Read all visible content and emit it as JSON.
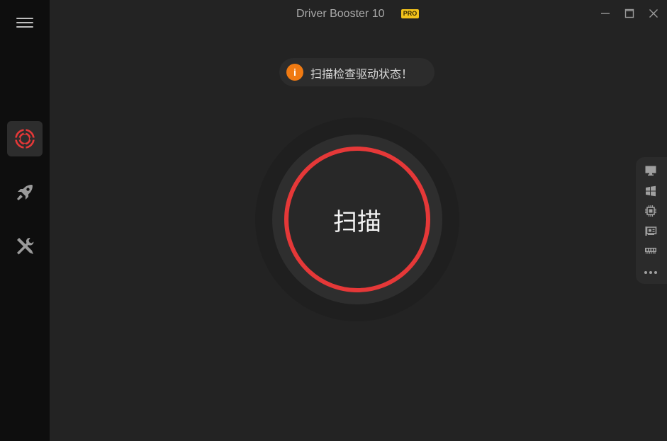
{
  "window": {
    "title": "Driver Booster 10",
    "badge": "PRO"
  },
  "sidebar": {
    "items": [
      {
        "name": "scan",
        "icon": "target-icon",
        "active": true
      },
      {
        "name": "boost",
        "icon": "rocket-icon",
        "active": false
      },
      {
        "name": "tools",
        "icon": "tools-icon",
        "active": false
      }
    ]
  },
  "notice": {
    "icon": "i",
    "text": "扫描检查驱动状态！"
  },
  "scan": {
    "label": "扫描"
  },
  "side_panel": {
    "icons": [
      "monitor-icon",
      "windows-icon",
      "chip-icon",
      "network-card-icon",
      "memory-icon",
      "more-icon"
    ]
  },
  "colors": {
    "accent": "#e53838",
    "notice": "#f07a12",
    "badge": "#f2c21b",
    "background": "#232323",
    "sidebar": "#0e0e0e"
  }
}
